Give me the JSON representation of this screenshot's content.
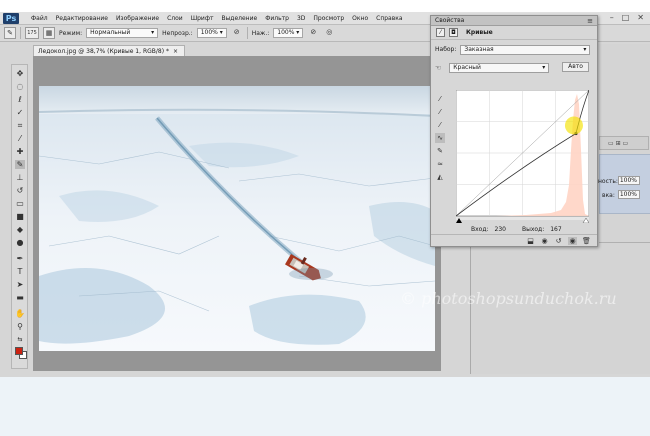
{
  "app": {
    "logo": "Ps"
  },
  "menu": [
    "Файл",
    "Редактирование",
    "Изображение",
    "Слои",
    "Шрифт",
    "Выделение",
    "Фильтр",
    "3D",
    "Просмотр",
    "Окно",
    "Справка"
  ],
  "window_controls": [
    "–",
    "□",
    "✕"
  ],
  "options_bar": {
    "brush_size": "175",
    "mode_label": "Режим:",
    "mode_value": "Нормальный",
    "opacity_label": "Непрозр.:",
    "opacity_value": "100%",
    "flow_label": "Наж.:",
    "flow_value": "100%"
  },
  "document": {
    "tab_title": "Ледокол.jpg @ 38,7% (Кривые 1, RGB/8) *",
    "tab_close": "×"
  },
  "properties": {
    "panel_title": "Свойства",
    "adjustment": "Кривые",
    "preset_label": "Набор:",
    "preset_value": "Заказная",
    "channel_value": "Красный",
    "auto_label": "Авто",
    "input_label": "Вход:",
    "input_value": "230",
    "output_label": "Выход:",
    "output_value": "167",
    "curve_point": {
      "input": 230,
      "output": 167
    }
  },
  "layers_fragment": {
    "opacity_label": "ность:",
    "opacity_value": "100%",
    "fill_label": "вка:",
    "fill_value": "100%"
  },
  "watermark": "© photoshopsunduchok.ru",
  "colors": {
    "foreground": "#cc2211",
    "background": "#ffffff",
    "channel_curve": "#ff9a80"
  },
  "icons": {
    "tools": [
      "move-icon",
      "marquee-icon",
      "lasso-icon",
      "quick-select-icon",
      "crop-icon",
      "eyedropper-icon",
      "spot-heal-icon",
      "brush-icon",
      "stamp-icon",
      "history-brush-icon",
      "eraser-icon",
      "gradient-icon",
      "blur-icon",
      "dodge-icon",
      "pen-icon",
      "type-icon",
      "path-select-icon",
      "shape-icon",
      "hand-icon",
      "zoom-icon"
    ]
  }
}
